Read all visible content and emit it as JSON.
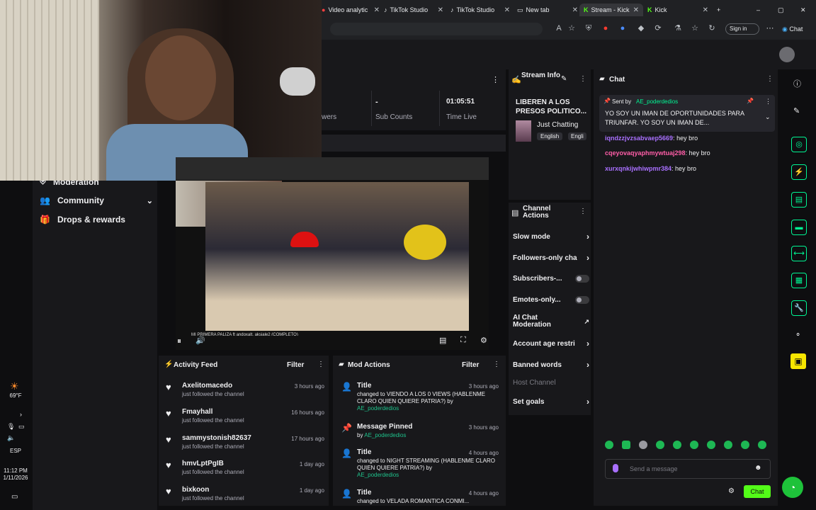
{
  "browser": {
    "tabs": [
      {
        "label": "Video analytic",
        "active": false
      },
      {
        "label": "TikTok Studio",
        "active": false
      },
      {
        "label": "TikTok Studio",
        "active": false
      },
      {
        "label": "New tab",
        "active": false
      },
      {
        "label": "Stream - Kick",
        "active": true
      },
      {
        "label": "Kick",
        "active": false
      }
    ],
    "sign_in": "Sign in",
    "chat_label": "Chat"
  },
  "stats": {
    "viewers_label": "wers",
    "sub_counts_value": "-",
    "sub_counts_label": "Sub Counts",
    "time_live_value": "01:05:51",
    "time_live_label": "Time Live"
  },
  "left_nav": {
    "items": [
      {
        "label": "Moderation"
      },
      {
        "label": "Community"
      },
      {
        "label": "Drops & rewards"
      }
    ]
  },
  "stream_info": {
    "header": "Stream Info",
    "title": "LIBEREN A LOS PRESOS POLITICO...",
    "category": "Just Chatting",
    "tags": [
      "English",
      "Engli"
    ]
  },
  "channel_actions": {
    "header": "Channel Actions",
    "items": [
      {
        "label": "Slow mode",
        "control": "arrow"
      },
      {
        "label": "Followers-only cha",
        "control": "arrow"
      },
      {
        "label": "Subscribers-...",
        "control": "toggle"
      },
      {
        "label": "Emotes-only...",
        "control": "toggle"
      },
      {
        "label": "AI Chat Moderation",
        "control": "link"
      },
      {
        "label": "Account age restri",
        "control": "arrow"
      },
      {
        "label": "Banned words",
        "control": "arrow"
      },
      {
        "label": "Host Channel",
        "control": "none"
      },
      {
        "label": "Set goals",
        "control": "arrow"
      }
    ]
  },
  "chat": {
    "header": "Chat",
    "pinned_by_label": "Sent by",
    "pinned_user": "AE_poderdedios",
    "pinned_text": "YO SOY UN IMAN DE OPORTUNIDADES PARA TRIUNFAR. YO SOY UN IMAN DE...",
    "messages": [
      {
        "user": "iqndzzjvzsabvaep5669",
        "text": "hey bro",
        "color": "#a970ff"
      },
      {
        "user": "cqeyovaqyaphmywtuaj298",
        "text": "hey bro",
        "color": "#ff5ea8"
      },
      {
        "user": "xurxqnkijwhiwpmr384",
        "text": "hey bro",
        "color": "#a970ff"
      }
    ],
    "input_placeholder": "Send a message",
    "send_label": "Chat"
  },
  "video": {
    "caption": "MI PRIMERA PALIZA ft andoxalt, aksiale2 (COMPLETO)"
  },
  "activity_feed": {
    "header": "Activity Feed",
    "filter_label": "Filter",
    "items": [
      {
        "name": "Axelitomacedo",
        "sub": "just followed the channel",
        "time": "3 hours ago"
      },
      {
        "name": "Fmayhall",
        "sub": "just followed the channel",
        "time": "16 hours ago"
      },
      {
        "name": "sammystonish82637",
        "sub": "just followed the channel",
        "time": "17 hours ago"
      },
      {
        "name": "hmvLptPgIB",
        "sub": "just followed the channel",
        "time": "1 day ago"
      },
      {
        "name": "bixkoon",
        "sub": "just followed the channel",
        "time": "1 day ago"
      }
    ]
  },
  "mod_actions": {
    "header": "Mod Actions",
    "filter_label": "Filter",
    "items": [
      {
        "title": "Title",
        "desc": "changed to VIENDO A LOS 0 VIEWS (HABLENME CLARO QUIEN QUIERE PATRIA?) by",
        "by": "AE_poderdedios",
        "time": "3 hours ago",
        "icon": "user"
      },
      {
        "title": "Message Pinned",
        "desc": "by",
        "by": "AE_poderdedios",
        "time": "3 hours ago",
        "icon": "pin"
      },
      {
        "title": "Title",
        "desc": "changed to NIGHT STREAMING (HABLENME CLARO QUIEN QUIERE PATRIA?) by",
        "by": "AE_poderdedios",
        "time": "4 hours ago",
        "icon": "user"
      },
      {
        "title": "Title",
        "desc": "changed to VELADA ROMANTICA CONMI...",
        "by": "",
        "time": "4 hours ago",
        "icon": "user"
      }
    ]
  },
  "taskbar": {
    "temp": "69°F",
    "lang": "ESP",
    "time": "11:12 PM",
    "date": "1/11/2026"
  }
}
